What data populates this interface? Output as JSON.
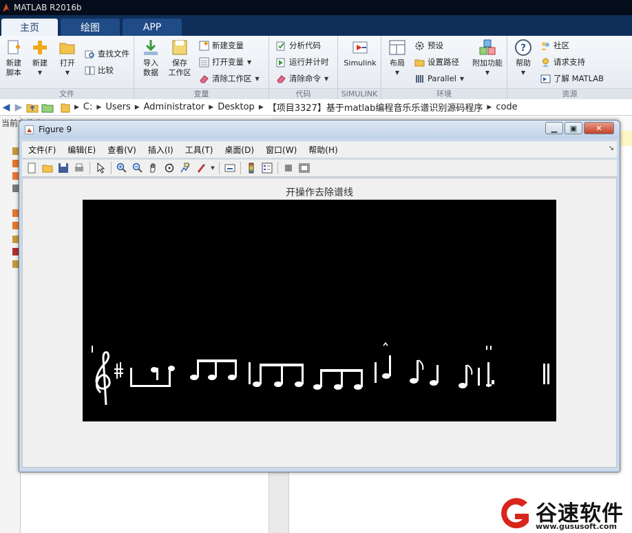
{
  "app": {
    "title": "MATLAB R2016b"
  },
  "tabs": [
    {
      "label": "主页",
      "active": true
    },
    {
      "label": "绘图",
      "active": false
    },
    {
      "label": "APP",
      "active": false
    }
  ],
  "ribbon": {
    "file": {
      "label": "文件",
      "new_script": "新建\n脚本",
      "new": "新建",
      "open": "打开",
      "find_files": "查找文件",
      "compare": "比较"
    },
    "variable": {
      "label": "变量",
      "import": "导入\n数据",
      "save_ws": "保存\n工作区",
      "new_var": "新建变量",
      "open_var": "打开变量",
      "clear_ws": "清除工作区"
    },
    "code": {
      "label": "代码",
      "analyze": "分析代码",
      "run_time": "运行并计时",
      "clear_cmd": "清除命令"
    },
    "simulink": {
      "label": "SIMULINK",
      "button": "Simulink"
    },
    "environment": {
      "label": "环境",
      "layout": "布局",
      "preferences": "预设",
      "set_path": "设置路径",
      "parallel": "Parallel",
      "addons": "附加功能"
    },
    "resources": {
      "label": "资源",
      "help": "帮助",
      "community": "社区",
      "support": "请求支持",
      "learn": "了解 MATLAB"
    }
  },
  "address": {
    "segments": [
      "C:",
      "Users",
      "Administrator",
      "Desktop",
      "【项目3327】基于matlab编程音乐乐谱识别源码程序",
      "code"
    ]
  },
  "background": {
    "current_folder": "当前文件夹"
  },
  "figure": {
    "title": "Figure 9",
    "menus": [
      "文件(F)",
      "编辑(E)",
      "查看(V)",
      "插入(I)",
      "工具(T)",
      "桌面(D)",
      "窗口(W)",
      "帮助(H)"
    ],
    "plot_title": "开操作去除谱线"
  },
  "watermark": {
    "name": "谷速软件",
    "url": "www.gususoft.com"
  },
  "colors": {
    "tabstrip": "#0f2e5a",
    "accent": "#1f4b86",
    "plot_bg": "#000000",
    "watermark_red": "#d9251c"
  }
}
